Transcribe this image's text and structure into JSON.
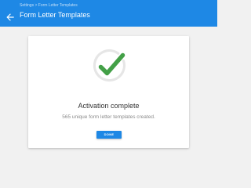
{
  "header": {
    "breadcrumb": "Settings > Form Letter Templates",
    "title": "Form Letter Templates",
    "background_color": "#1e88e5",
    "back_icon": "arrow-left-icon"
  },
  "card": {
    "icon": "checkmark-success-icon",
    "icon_color": "#43a047",
    "ring_color": "#e6e6e6",
    "headline": "Activation complete",
    "message": "565 unique form letter templates created.",
    "done_label": "DONE"
  },
  "page": {
    "background_color": "#f1f1f1"
  }
}
